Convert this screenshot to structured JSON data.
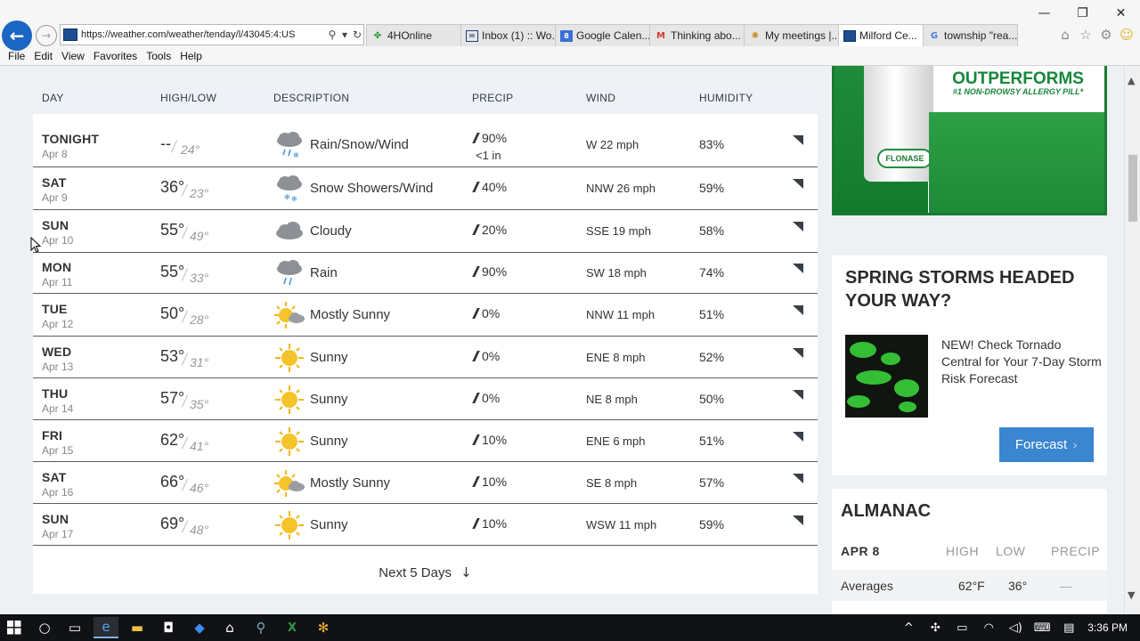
{
  "browser": {
    "url": "https://weather.com/weather/tenday/l/43045:4:US",
    "tabs": [
      {
        "label": "4HOnline",
        "icon": "clover-icon",
        "active": false
      },
      {
        "label": "Inbox (1) :: Wo...",
        "icon": "mail-icon",
        "active": false
      },
      {
        "label": "Google Calen...",
        "icon": "calendar-icon",
        "active": false
      },
      {
        "label": "Thinking abo...",
        "icon": "gmail-icon",
        "active": false
      },
      {
        "label": "My meetings |...",
        "icon": "meeting-icon",
        "active": false
      },
      {
        "label": "Milford Ce...",
        "icon": "weather-tab-icon",
        "active": true
      },
      {
        "label": "township \"rea...",
        "icon": "google-icon",
        "active": false
      }
    ],
    "menu": [
      "File",
      "Edit",
      "View",
      "Favorites",
      "Tools",
      "Help"
    ]
  },
  "forecast": {
    "headers": {
      "day": "DAY",
      "highlow": "HIGH/LOW",
      "description": "DESCRIPTION",
      "precip": "PRECIP",
      "wind": "WIND",
      "humidity": "HUMIDITY"
    },
    "days": [
      {
        "name": "TONIGHT",
        "date": "Apr 8",
        "high": "--",
        "low": "24°",
        "icon": "rain-snow-icon",
        "desc": "Rain/Snow/Wind",
        "precip": "90%",
        "precip_amount": "<1 in",
        "wind": "W 22 mph",
        "humidity": "83%"
      },
      {
        "name": "SAT",
        "date": "Apr 9",
        "high": "36°",
        "low": "23°",
        "icon": "snow-showers-icon",
        "desc": "Snow Showers/Wind",
        "precip": "40%",
        "wind": "NNW 26 mph",
        "humidity": "59%"
      },
      {
        "name": "SUN",
        "date": "Apr 10",
        "high": "55°",
        "low": "49°",
        "icon": "cloudy-icon",
        "desc": "Cloudy",
        "precip": "20%",
        "wind": "SSE 19 mph",
        "humidity": "58%"
      },
      {
        "name": "MON",
        "date": "Apr 11",
        "high": "55°",
        "low": "33°",
        "icon": "rain-icon",
        "desc": "Rain",
        "precip": "90%",
        "wind": "SW 18 mph",
        "humidity": "74%"
      },
      {
        "name": "TUE",
        "date": "Apr 12",
        "high": "50°",
        "low": "28°",
        "icon": "mostly-sunny-icon",
        "desc": "Mostly Sunny",
        "precip": "0%",
        "wind": "NNW 11 mph",
        "humidity": "51%"
      },
      {
        "name": "WED",
        "date": "Apr 13",
        "high": "53°",
        "low": "31°",
        "icon": "sunny-icon",
        "desc": "Sunny",
        "precip": "0%",
        "wind": "ENE 8 mph",
        "humidity": "52%"
      },
      {
        "name": "THU",
        "date": "Apr 14",
        "high": "57°",
        "low": "35°",
        "icon": "sunny-icon",
        "desc": "Sunny",
        "precip": "0%",
        "wind": "NE 8 mph",
        "humidity": "50%"
      },
      {
        "name": "FRI",
        "date": "Apr 15",
        "high": "62°",
        "low": "41°",
        "icon": "sunny-icon",
        "desc": "Sunny",
        "precip": "10%",
        "wind": "ENE 6 mph",
        "humidity": "51%"
      },
      {
        "name": "SAT",
        "date": "Apr 16",
        "high": "66°",
        "low": "46°",
        "icon": "mostly-sunny-icon",
        "desc": "Mostly Sunny",
        "precip": "10%",
        "wind": "SE 8 mph",
        "humidity": "57%"
      },
      {
        "name": "SUN",
        "date": "Apr 17",
        "high": "69°",
        "low": "48°",
        "icon": "sunny-icon",
        "desc": "Sunny",
        "precip": "10%",
        "wind": "WSW 11 mph",
        "humidity": "59%"
      }
    ],
    "next_label": "Next 5 Days"
  },
  "ad": {
    "headline": "OUTPERFORMS",
    "subline": "#1 NON-DROWSY ALLERGY PILL*",
    "brand": "FLONASE"
  },
  "storms": {
    "title": "SPRING STORMS HEADED YOUR WAY?",
    "text": "NEW! Check Tornado Central for Your 7-Day Storm Risk Forecast",
    "button": "Forecast"
  },
  "almanac": {
    "title": "ALMANAC",
    "date": "APR 8",
    "col_high": "HIGH",
    "col_low": "LOW",
    "col_precip": "PRECIP",
    "row_label": "Averages",
    "row_high": "62°F",
    "row_low": "36°",
    "row_precip": "—"
  },
  "taskbar": {
    "clock": "3:36 PM"
  },
  "colors": {
    "accent": "#1a66c2",
    "forecast_button": "#3a86d0",
    "ad_green": "#1f8c3a"
  }
}
